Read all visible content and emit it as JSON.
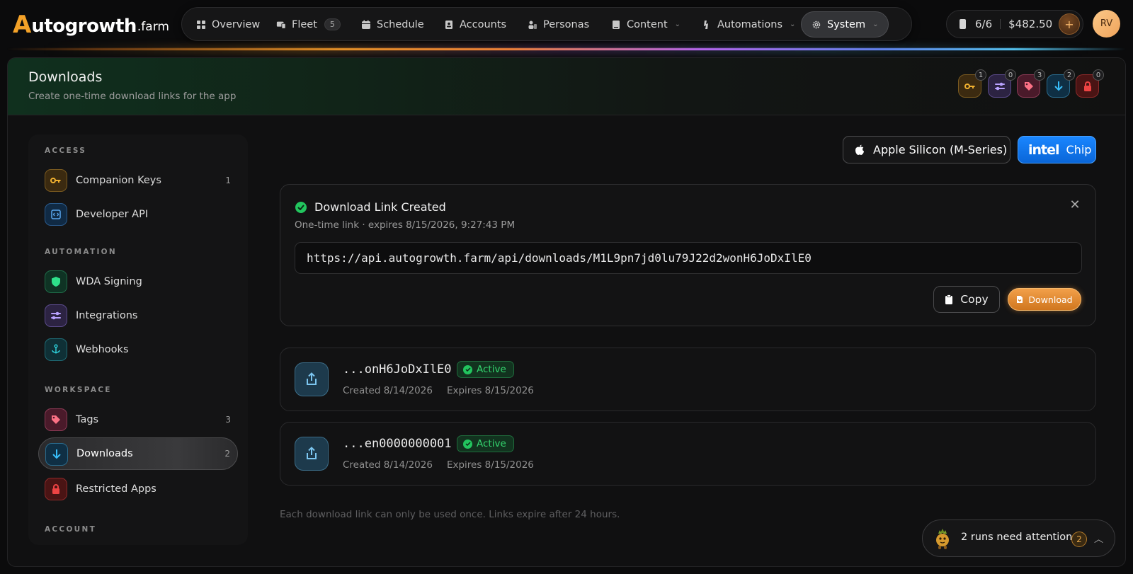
{
  "brand": {
    "logo_a": "A",
    "logo_rest": "utogrowth",
    "logo_farm": ".farm"
  },
  "nav": {
    "items": [
      {
        "label": "Overview"
      },
      {
        "label": "Fleet",
        "badge": "5"
      },
      {
        "label": "Schedule"
      },
      {
        "label": "Accounts"
      },
      {
        "label": "Personas"
      },
      {
        "label": "Content"
      },
      {
        "label": "Automations"
      },
      {
        "label": "System"
      }
    ],
    "active": "System"
  },
  "credits": {
    "devices": "6/6",
    "balance": "$482.50",
    "add_label": "+"
  },
  "user": {
    "initials": "RV"
  },
  "page": {
    "title": "Downloads",
    "subtitle": "Create one-time download links for the app",
    "header_icons": [
      {
        "name": "key",
        "count": "1",
        "color": "#e6a020"
      },
      {
        "name": "sliders",
        "count": "0",
        "color": "#a78bfa"
      },
      {
        "name": "tag",
        "count": "3",
        "color": "#f472b6"
      },
      {
        "name": "download",
        "count": "2",
        "color": "#38bdf8"
      },
      {
        "name": "lock",
        "count": "0",
        "color": "#ef4444"
      }
    ]
  },
  "sidebar": {
    "sections": {
      "access": "ACCESS",
      "automation": "AUTOMATION",
      "workspace": "WORKSPACE",
      "account": "ACCOUNT"
    },
    "items": [
      {
        "label": "Companion Keys",
        "count": "1",
        "icon": "key-icon"
      },
      {
        "label": "Developer API",
        "count": "",
        "icon": "api-icon"
      },
      {
        "label": "WDA Signing",
        "count": "",
        "icon": "shield-icon"
      },
      {
        "label": "Integrations",
        "count": "",
        "icon": "sliders-icon"
      },
      {
        "label": "Webhooks",
        "count": "",
        "icon": "anchor-icon"
      },
      {
        "label": "Tags",
        "count": "3",
        "icon": "tag-icon"
      },
      {
        "label": "Downloads",
        "count": "2",
        "icon": "download-icon"
      },
      {
        "label": "Restricted Apps",
        "count": "",
        "icon": "lock-icon"
      }
    ],
    "active": "Downloads"
  },
  "chips": {
    "apple_label": "Apple Silicon (M-Series)",
    "intel_logo": "intel",
    "intel_label": "Chip",
    "selected": "intel"
  },
  "created": {
    "title": "Download Link Created",
    "subtitle": "One-time link · expires 8/15/2026, 9:27:43 PM",
    "url": "https://api.autogrowth.farm/api/downloads/M1L9pn7jd0lu79J22d2wonH6JoDxIlE0",
    "copy_label": "Copy",
    "download_label": "Download"
  },
  "links": [
    {
      "id": "...onH6JoDxIlE0",
      "status": "Active",
      "created": "Created 8/14/2026",
      "expires": "Expires 8/15/2026"
    },
    {
      "id": "...en0000000001",
      "status": "Active",
      "created": "Created 8/14/2026",
      "expires": "Expires 8/15/2026"
    }
  ],
  "footnote": "Each download link can only be used once. Links expire after 24 hours.",
  "attention": {
    "text": "2 runs need attention",
    "count": "2"
  }
}
